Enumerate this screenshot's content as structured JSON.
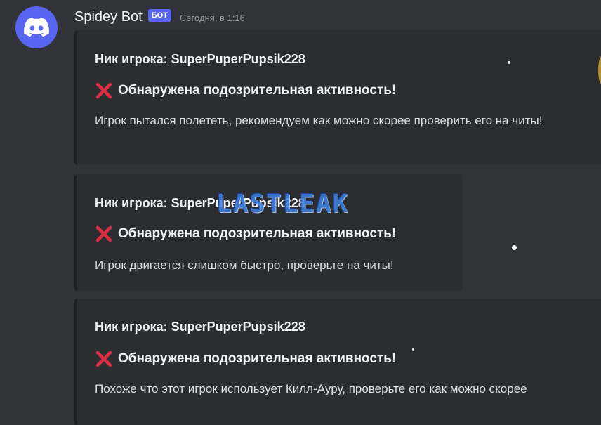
{
  "message": {
    "username": "Spidey Bot",
    "bot_badge": "БОТ",
    "timestamp": "Сегодня, в 1:16",
    "avatar_icon": "discord-logo-icon"
  },
  "embeds": [
    {
      "nick_label": "Ник игрока: SuperPuperPupsik228",
      "alert_icon": "cross-mark-icon",
      "alert_text": "Обнаружена подозрительная активность!",
      "description": "Игрок пытался полететь, рекомендуем как можно скорее проверить его на читы!"
    },
    {
      "nick_label": "Ник игрока: SuperPuperPupsik228",
      "alert_icon": "cross-mark-icon",
      "alert_text": "Обнаружена подозрительная активность!",
      "description": "Игрок двигается слишком быстро, проверьте на читы!"
    },
    {
      "nick_label": "Ник игрока: SuperPuperPupsik228",
      "alert_icon": "cross-mark-icon",
      "alert_text": "Обнаружена подозрительная активность!",
      "description": "Похоже что этот игрок использует Килл-Ауру, проверьте его как можно скорее"
    }
  ],
  "watermark": {
    "text": "LASTLEAK"
  },
  "colors": {
    "background": "#313338",
    "embed_background": "#2b2d31",
    "brand": "#5865f2",
    "alert_red": "#dd2e44"
  }
}
